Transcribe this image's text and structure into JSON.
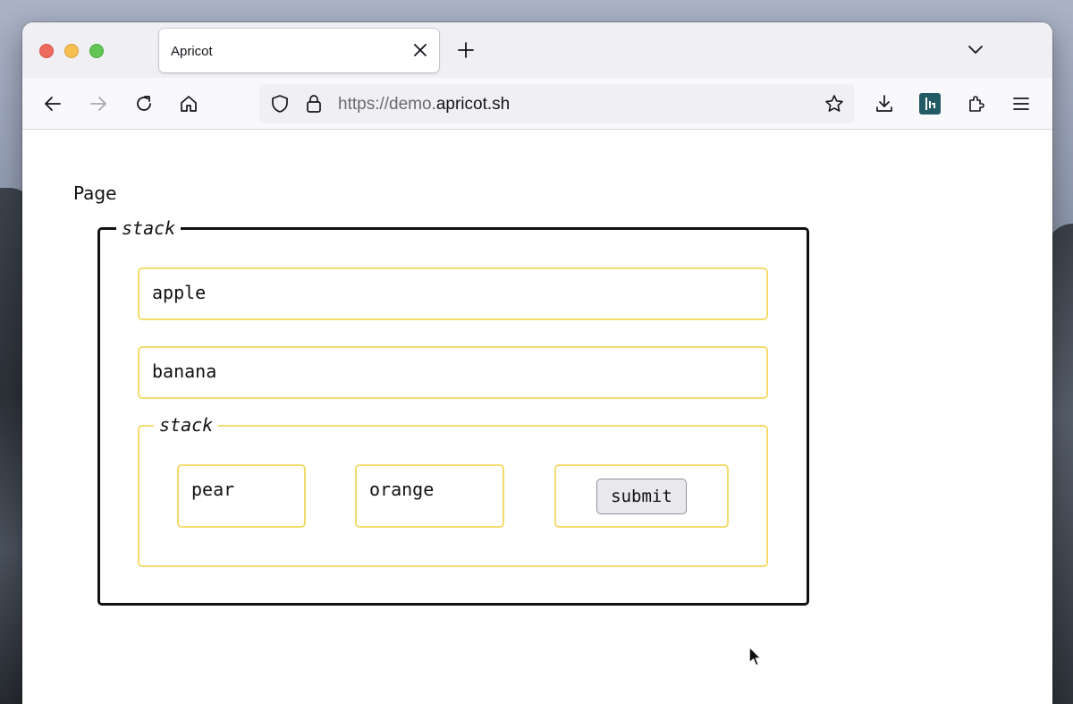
{
  "browser": {
    "tab_title": "Apricot",
    "url_prefix": "https://demo.",
    "url_domain": "apricot.sh"
  },
  "page": {
    "label": "Page",
    "outer_stack": {
      "legend": "stack",
      "items": [
        "apple",
        "banana"
      ],
      "inner_stack": {
        "legend": "stack",
        "items": [
          "pear",
          "orange"
        ],
        "submit_label": "submit"
      }
    }
  },
  "colors": {
    "box_border": "#f3dc6e",
    "outer_border": "#111111"
  },
  "icons": [
    "back-icon",
    "forward-icon",
    "reload-icon",
    "home-icon",
    "shield-icon",
    "lock-icon",
    "star-icon",
    "download-icon",
    "extension-app-icon",
    "puzzle-icon",
    "menu-icon",
    "close-icon",
    "plus-icon",
    "chevron-down-icon",
    "mouse-cursor-icon"
  ]
}
